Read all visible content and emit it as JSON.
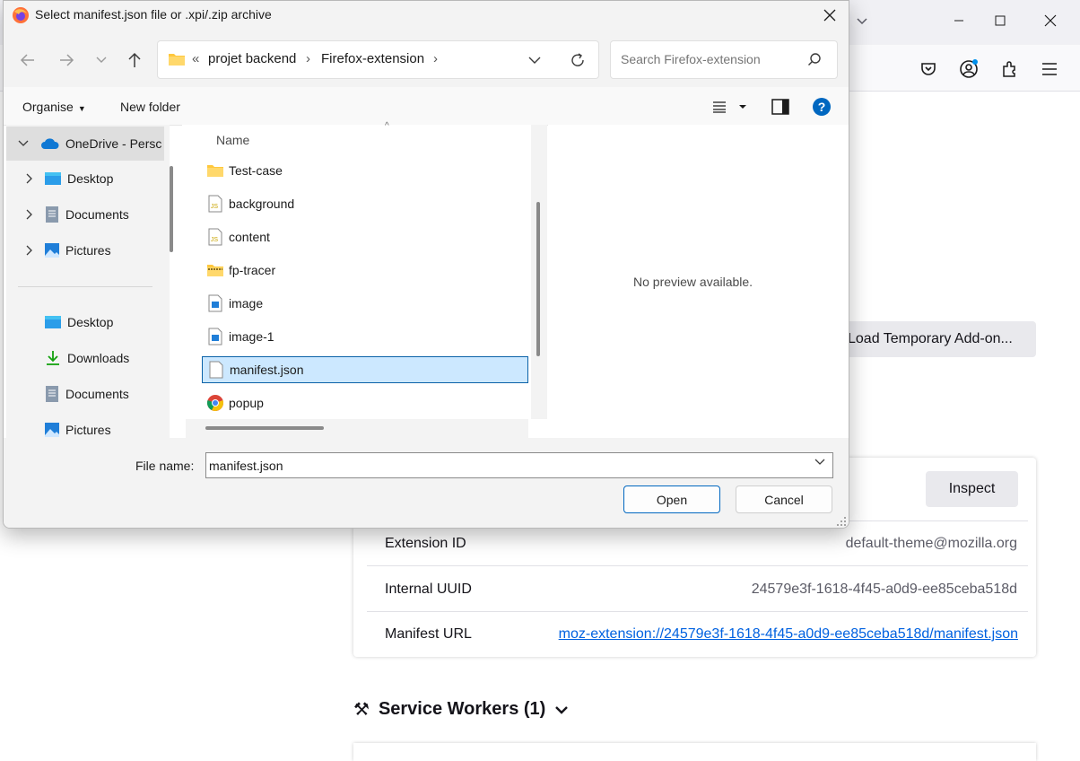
{
  "firefox": {
    "load_button": "Load Temporary Add-on...",
    "inspect_button": "Inspect",
    "rows": [
      {
        "label": "Extension ID",
        "value": "default-theme@mozilla.org"
      },
      {
        "label": "Internal UUID",
        "value": "24579e3f-1618-4f45-a0d9-ee85ceba518d"
      },
      {
        "label": "Manifest URL",
        "value": "moz-extension://24579e3f-1618-4f45-a0d9-ee85ceba518d/manifest.json"
      }
    ],
    "service_workers_heading": "Service Workers (1)"
  },
  "dialog": {
    "title": "Select manifest.json file or .xpi/.zip archive",
    "breadcrumb": {
      "overflow": "«",
      "items": [
        "projet backend",
        "Firefox-extension"
      ]
    },
    "search_placeholder": "Search Firefox-extension",
    "organise_label": "Organise",
    "new_folder_label": "New folder",
    "sidebar": {
      "tree": [
        {
          "label": "OneDrive - Persc",
          "icon": "onedrive-icon",
          "expanded": true
        },
        {
          "label": "Desktop",
          "icon": "desktop-icon"
        },
        {
          "label": "Documents",
          "icon": "documents-icon"
        },
        {
          "label": "Pictures",
          "icon": "pictures-icon"
        }
      ],
      "quick": [
        {
          "label": "Desktop",
          "icon": "desktop-icon"
        },
        {
          "label": "Downloads",
          "icon": "downloads-icon"
        },
        {
          "label": "Documents",
          "icon": "documents-icon"
        },
        {
          "label": "Pictures",
          "icon": "pictures-icon"
        }
      ]
    },
    "column_header": "Name",
    "files": [
      {
        "name": "Test-case",
        "icon": "folder-icon"
      },
      {
        "name": "background",
        "icon": "js-file-icon"
      },
      {
        "name": "content",
        "icon": "js-file-icon"
      },
      {
        "name": "fp-tracer",
        "icon": "zip-folder-icon"
      },
      {
        "name": "image",
        "icon": "image-file-icon"
      },
      {
        "name": "image-1",
        "icon": "image-file-icon"
      },
      {
        "name": "manifest.json",
        "icon": "file-icon",
        "selected": true
      },
      {
        "name": "popup",
        "icon": "chrome-icon"
      }
    ],
    "preview_text": "No preview available.",
    "file_name_label": "File name:",
    "file_name_value": "manifest.json",
    "open_label": "Open",
    "cancel_label": "Cancel"
  }
}
